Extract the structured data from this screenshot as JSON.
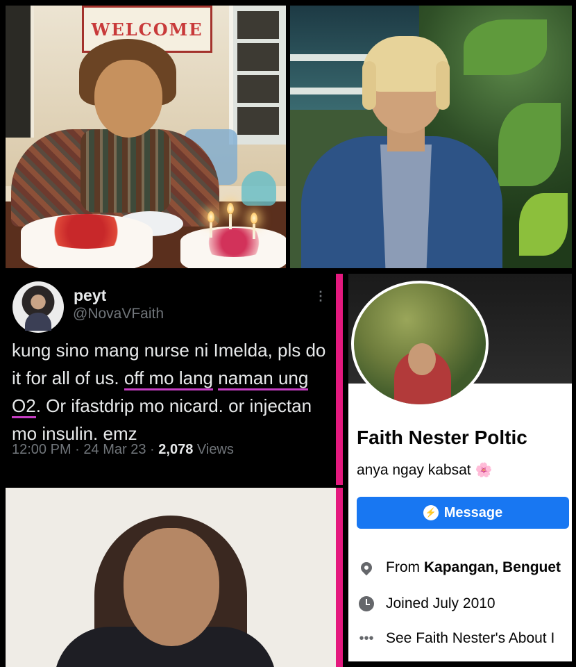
{
  "photo1": {
    "frame_text": "WELCOME"
  },
  "tweet": {
    "name": "peyt",
    "handle": "@NovaVFaith",
    "more_icon": "more-vertical-icon",
    "text_parts": {
      "part1": "kung sino mang nurse ni Imelda, pls do it for all of us. ",
      "highlight1": "off mo lang",
      "highlight2": "naman ung O2",
      "part2": ". Or ifastdrip mo nicard. or injectan mo insulin. emz"
    },
    "time": "12:00 PM",
    "date": "24 Mar 23",
    "views_count": "2,078",
    "views_label": "Views",
    "separator": "·"
  },
  "facebook": {
    "name": "Faith Nester Poltic",
    "bio": "anya ngay kabsat",
    "bio_emoji": "🌸",
    "message_button": "Message",
    "from_prefix": "From",
    "from_place": "Kapangan, Benguet",
    "joined": "Joined July 2010",
    "about_link": "See Faith Nester's About I",
    "colors": {
      "button": "#1877f2",
      "text": "#050505",
      "icon": "#65676b"
    }
  },
  "colors": {
    "divider_pink": "#e4197e",
    "underline_purple": "#c73ec4"
  }
}
